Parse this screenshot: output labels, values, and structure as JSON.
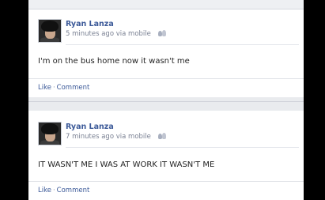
{
  "posts": [
    {
      "author": "Ryan Lanza",
      "time": "5 minutes ago",
      "via": "via mobile",
      "text": "I'm on the bus home now it wasn't me",
      "like": "Like",
      "comment": "Comment",
      "separator": "·"
    },
    {
      "author": "Ryan Lanza",
      "time": "7 minutes ago",
      "via": "via mobile",
      "text": "IT WASN'T ME I WAS AT WORK IT WASN'T ME",
      "like": "Like",
      "comment": "Comment",
      "separator": "·"
    }
  ],
  "colors": {
    "link": "#3b5998",
    "meta": "#7a8193",
    "background": "#e9ebee"
  }
}
